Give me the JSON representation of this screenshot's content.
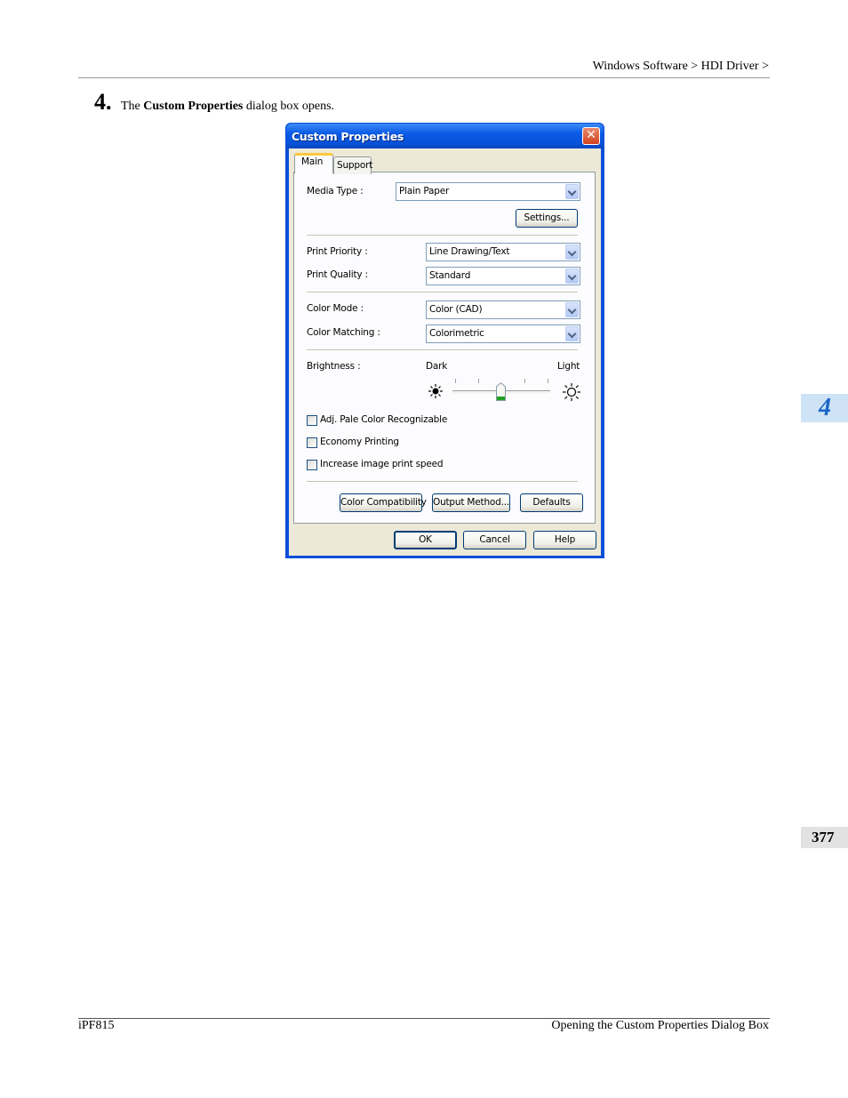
{
  "page": {
    "breadcrumb": "Windows Software > HDI Driver >",
    "step_number": "4.",
    "step_text_pre": "The ",
    "step_text_bold": "Custom Properties",
    "step_text_post": " dialog box opens.",
    "chapter_tab": "4",
    "page_number": "377",
    "footer_left": "iPF815",
    "footer_right": "Opening the Custom Properties Dialog Box"
  },
  "dialog": {
    "title": "Custom Properties",
    "close_glyph": "✕",
    "tabs": [
      {
        "label": "Main",
        "selected": true
      },
      {
        "label": "Support",
        "selected": false
      }
    ],
    "media_type": {
      "label": "Media Type :",
      "value": "Plain Paper"
    },
    "settings_button": "Settings...",
    "print_priority": {
      "label": "Print Priority :",
      "value": "Line Drawing/Text"
    },
    "print_quality": {
      "label": "Print Quality :",
      "value": "Standard"
    },
    "color_mode": {
      "label": "Color Mode :",
      "value": "Color (CAD)"
    },
    "color_matching": {
      "label": "Color Matching :",
      "value": "Colorimetric"
    },
    "brightness": {
      "label": "Brightness :",
      "dark_label": "Dark",
      "light_label": "Light",
      "level_fraction": 0.5
    },
    "checkboxes": [
      {
        "label": "Adj. Pale Color Recognizable",
        "checked": false
      },
      {
        "label": "Economy Printing",
        "checked": false
      },
      {
        "label": "Increase image print speed",
        "checked": false
      }
    ],
    "buttons": {
      "color_compatibility": "Color Compatibility",
      "output_method": "Output Method...",
      "defaults": "Defaults",
      "ok": "OK",
      "cancel": "Cancel",
      "help": "Help"
    },
    "colors": {
      "title_bar": "#0a5ae6",
      "face": "#ece9d8",
      "close": "#d4411c",
      "tab_highlight": "#ffc83c",
      "chapter_tab_text": "#1a64c8"
    }
  }
}
